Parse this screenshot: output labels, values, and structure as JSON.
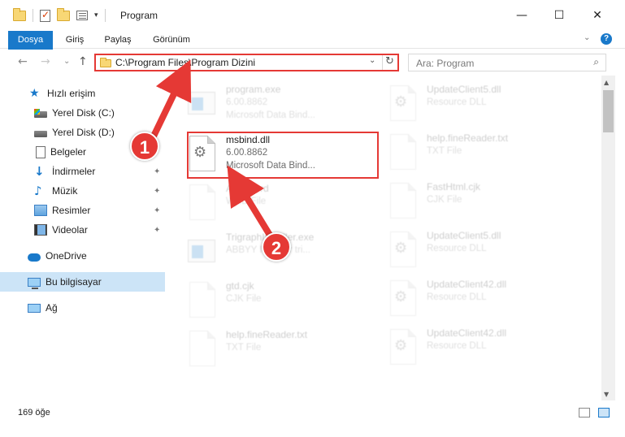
{
  "window": {
    "title": "Program",
    "minimize_glyph": "—",
    "maximize_glyph": "☐",
    "close_glyph": "✕"
  },
  "quick_access_toolbar": {
    "dropdown_glyph": "▾"
  },
  "ribbon": {
    "tabs": [
      "Dosya",
      "Giriş",
      "Paylaş",
      "Görünüm"
    ],
    "expand_glyph": "⌄",
    "help_glyph": "?"
  },
  "navigation": {
    "back_glyph": "←",
    "forward_glyph": "→",
    "recent_glyph": "⌄",
    "up_glyph": "↑",
    "address": "C:\\Program Files\\Program Dizini",
    "address_dropdown_glyph": "⌄",
    "refresh_glyph": "↻",
    "search_placeholder": "Ara: Program",
    "search_glyph": "⌕"
  },
  "sidebar": {
    "items": [
      {
        "label": "Hızlı erişim",
        "icon": "quick-access-star-icon"
      },
      {
        "label": "Yerel Disk (C:)",
        "icon": "local-disk-icon"
      },
      {
        "label": "Yerel Disk (D:)",
        "icon": "local-disk-icon"
      },
      {
        "label": "Belgeler",
        "icon": "documents-icon"
      },
      {
        "label": "İndirmeler",
        "icon": "downloads-icon"
      },
      {
        "label": "Müzik",
        "icon": "music-icon"
      },
      {
        "label": "Resimler",
        "icon": "pictures-icon"
      },
      {
        "label": "Videolar",
        "icon": "videos-icon"
      },
      {
        "label": "OneDrive",
        "icon": "onedrive-cloud-icon"
      },
      {
        "label": "Bu bilgisayar",
        "icon": "this-pc-icon"
      },
      {
        "label": "Ağ",
        "icon": "network-icon"
      }
    ],
    "pin_glyph": "📌"
  },
  "files": {
    "left_column": [
      {
        "name": "program.exe",
        "line1": "6.00.8862",
        "line2": "Microsoft Data Bind...",
        "icon": "application-icon"
      },
      {
        "name": "msbind.dll",
        "line1": "6.00.8862",
        "line2": "Microsoft Data Bind...",
        "icon": "dll-gear-icon"
      },
      {
        "name": "Amsc.wrd",
        "line1": "WRD File",
        "line2": "",
        "icon": "generic-file-icon"
      },
      {
        "name": "TrigraphInstaller.exe",
        "line1": "ABBYY Installer tri...",
        "line2": "",
        "icon": "installer-icon"
      },
      {
        "name": "gtd.cjk",
        "line1": "CJK File",
        "line2": "",
        "icon": "generic-file-icon"
      },
      {
        "name": "help.fineReader.txt",
        "line1": "TXT File",
        "line2": "",
        "icon": "text-file-icon"
      }
    ],
    "right_column": [
      {
        "name": "UpdateClient5.dll",
        "line1": "Resource DLL",
        "icon": "dll-gear-icon"
      },
      {
        "name": "help.fineReader.txt",
        "line1": "TXT File",
        "icon": "text-file-icon"
      },
      {
        "name": "FastHtml.cjk",
        "line1": "CJK File",
        "icon": "generic-file-icon"
      },
      {
        "name": "UpdateClient5.dll",
        "line1": "Resource DLL",
        "icon": "dll-gear-icon"
      },
      {
        "name": "UpdateClient42.dll",
        "line1": "Resource DLL",
        "icon": "dll-gear-icon"
      },
      {
        "name": "UpdateClient42.dll",
        "line1": "Resource DLL",
        "icon": "dll-gear-icon"
      }
    ]
  },
  "scrollbar": {
    "up_glyph": "▲",
    "down_glyph": "▼"
  },
  "status_bar": {
    "item_count": "169 öğe"
  },
  "annotations": {
    "step1": "1",
    "step2": "2",
    "color": "#e53935"
  },
  "colors": {
    "accent": "#1979ca",
    "selection": "#cce4f7",
    "annotation_red": "#e53935"
  }
}
